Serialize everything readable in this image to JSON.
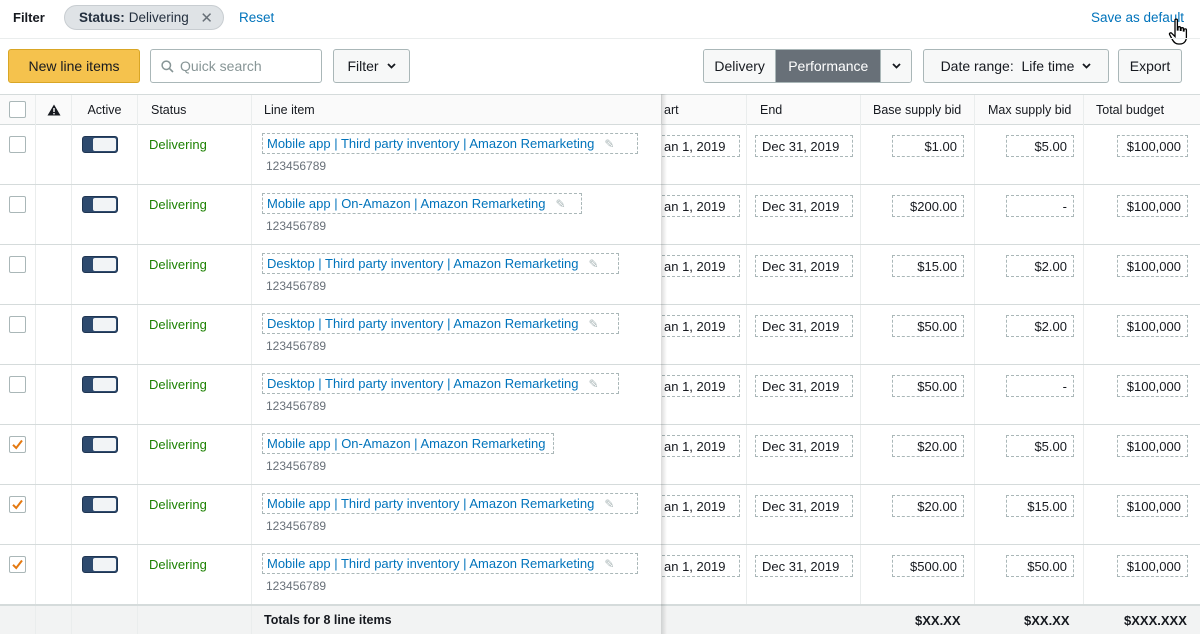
{
  "filterbar": {
    "label": "Filter",
    "chip_key": "Status:",
    "chip_value": "Delivering",
    "reset": "Reset",
    "save_default": "Save as default"
  },
  "toolbar": {
    "new_items": "New line items",
    "search_placeholder": "Quick search",
    "filter": "Filter",
    "view_delivery": "Delivery",
    "view_performance": "Performance",
    "date_range": "Date range:  Life time",
    "export": "Export"
  },
  "table": {
    "headers": {
      "active": "Active",
      "status": "Status",
      "line_item": "Line item",
      "start": "art",
      "end": "End",
      "base_bid": "Base supply bid",
      "max_bid": "Max supply bid",
      "total_budget": "Total budget"
    },
    "rows": [
      {
        "checked": false,
        "status": "Delivering",
        "name": "Mobile app | Third party inventory | Amazon Remarketing",
        "id": "123456789",
        "start": "an 1, 2019",
        "end": "Dec 31, 2019",
        "base": "$1.00",
        "max": "$5.00",
        "budget": "$100,000",
        "editable": true
      },
      {
        "checked": false,
        "status": "Delivering",
        "name": "Mobile app | On-Amazon | Amazon Remarketing",
        "id": "123456789",
        "start": "an 1, 2019",
        "end": "Dec 31, 2019",
        "base": "$200.00",
        "max": "-",
        "budget": "$100,000",
        "editable": true
      },
      {
        "checked": false,
        "status": "Delivering",
        "name": "Desktop | Third party inventory | Amazon Remarketing",
        "id": "123456789",
        "start": "an 1, 2019",
        "end": "Dec 31, 2019",
        "base": "$15.00",
        "max": "$2.00",
        "budget": "$100,000",
        "editable": true
      },
      {
        "checked": false,
        "status": "Delivering",
        "name": "Desktop | Third party inventory | Amazon Remarketing",
        "id": "123456789",
        "start": "an 1, 2019",
        "end": "Dec 31, 2019",
        "base": "$50.00",
        "max": "$2.00",
        "budget": "$100,000",
        "editable": true
      },
      {
        "checked": false,
        "status": "Delivering",
        "name": "Desktop | Third party inventory | Amazon Remarketing",
        "id": "123456789",
        "start": "an 1, 2019",
        "end": "Dec 31, 2019",
        "base": "$50.00",
        "max": "-",
        "budget": "$100,000",
        "editable": true
      },
      {
        "checked": true,
        "status": "Delivering",
        "name": "Mobile app | On-Amazon | Amazon Remarketing",
        "id": "123456789",
        "start": "an 1, 2019",
        "end": "Dec 31, 2019",
        "base": "$20.00",
        "max": "$5.00",
        "budget": "$100,000",
        "editable": false
      },
      {
        "checked": true,
        "status": "Delivering",
        "name": "Mobile app | Third party inventory | Amazon Remarketing",
        "id": "123456789",
        "start": "an 1, 2019",
        "end": "Dec 31, 2019",
        "base": "$20.00",
        "max": "$15.00",
        "budget": "$100,000",
        "editable": true
      },
      {
        "checked": true,
        "status": "Delivering",
        "name": "Mobile app | Third party inventory | Amazon Remarketing",
        "id": "123456789",
        "start": "an 1, 2019",
        "end": "Dec 31, 2019",
        "base": "$500.00",
        "max": "$50.00",
        "budget": "$100,000",
        "editable": true
      }
    ],
    "totals": {
      "label": "Totals for 8 line items",
      "base": "$XX.XX",
      "max": "$XX.XX",
      "budget": "$XXX.XXX"
    }
  },
  "colors": {
    "primary_button": "#f5c24d",
    "link": "#0073bb",
    "delivering": "#1d8102",
    "checkbox_accent": "#e47911",
    "toggle": "#2e4a6e"
  }
}
